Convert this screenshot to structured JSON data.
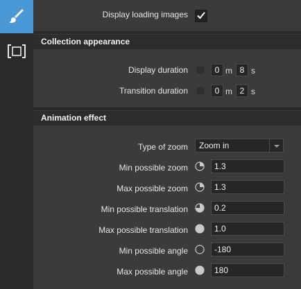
{
  "sidebar": {
    "items": [
      {
        "icon": "paintbrush-icon",
        "active": true
      },
      {
        "icon": "fullscreen-frame-icon",
        "active": false
      }
    ]
  },
  "general": {
    "display_loading_images": {
      "label": "Display loading images",
      "checked": true
    }
  },
  "collection_appearance": {
    "title": "Collection appearance",
    "display_duration": {
      "label": "Display duration",
      "minutes": "0",
      "minutes_unit": "m",
      "seconds": "8",
      "seconds_unit": "s"
    },
    "transition_duration": {
      "label": "Transition duration",
      "minutes": "0",
      "minutes_unit": "m",
      "seconds": "2",
      "seconds_unit": "s"
    }
  },
  "animation_effect": {
    "title": "Animation effect",
    "type_of_zoom": {
      "label": "Type of zoom",
      "value": "Zoom in"
    },
    "fields": [
      {
        "label": "Min possible zoom",
        "value": "1.3",
        "icon": "progress-pie-icon",
        "fill": 0.25
      },
      {
        "label": "Max possible zoom",
        "value": "1.3",
        "icon": "progress-pie-icon",
        "fill": 0.25
      },
      {
        "label": "Min possible translation",
        "value": "0.2",
        "icon": "progress-pie-icon",
        "fill": 0.75
      },
      {
        "label": "Max possible translation",
        "value": "1.0",
        "icon": "progress-pie-icon",
        "fill": 1.0
      },
      {
        "label": "Min possible angle",
        "value": "-180",
        "icon": "progress-pie-icon",
        "fill": 0.0
      },
      {
        "label": "Max possible angle",
        "value": "180",
        "icon": "progress-pie-icon",
        "fill": 1.0
      }
    ]
  },
  "colors": {
    "accent": "#4a97d6",
    "background": "#3b3b3b",
    "section_header": "#2c2c2c",
    "field_background": "#262626"
  }
}
